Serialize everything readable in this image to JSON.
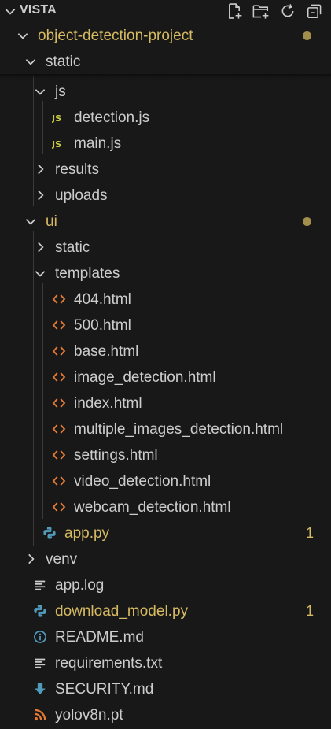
{
  "header": {
    "title": "VISTA",
    "actions": [
      {
        "name": "new-file-icon"
      },
      {
        "name": "new-folder-icon"
      },
      {
        "name": "refresh-icon"
      },
      {
        "name": "collapse-all-icon"
      }
    ]
  },
  "colors": {
    "background": "#181818",
    "text": "#cccccc",
    "modified": "#d6ba62",
    "dot": "#a18f4c",
    "js": "#cbcb41",
    "html": "#e37933",
    "python": "#519aba",
    "info": "#519aba",
    "download": "#519aba",
    "rss": "#e37933"
  },
  "tree": [
    {
      "label": "object-detection-project",
      "icon": "chevron-down-icon",
      "modified": true,
      "badge": "dot"
    },
    {
      "label": "static",
      "icon": "chevron-down-icon"
    },
    {
      "label": "js",
      "icon": "chevron-down-icon"
    },
    {
      "label": "detection.js",
      "icon": "js-file-icon"
    },
    {
      "label": "main.js",
      "icon": "js-file-icon"
    },
    {
      "label": "results",
      "icon": "chevron-right-icon"
    },
    {
      "label": "uploads",
      "icon": "chevron-right-icon"
    },
    {
      "label": "ui",
      "icon": "chevron-down-icon",
      "modified": true,
      "badge": "dot"
    },
    {
      "label": "static",
      "icon": "chevron-right-icon"
    },
    {
      "label": "templates",
      "icon": "chevron-down-icon"
    },
    {
      "label": "404.html",
      "icon": "html-file-icon"
    },
    {
      "label": "500.html",
      "icon": "html-file-icon"
    },
    {
      "label": "base.html",
      "icon": "html-file-icon"
    },
    {
      "label": "image_detection.html",
      "icon": "html-file-icon"
    },
    {
      "label": "index.html",
      "icon": "html-file-icon"
    },
    {
      "label": "multiple_images_detection.html",
      "icon": "html-file-icon"
    },
    {
      "label": "settings.html",
      "icon": "html-file-icon"
    },
    {
      "label": "video_detection.html",
      "icon": "html-file-icon"
    },
    {
      "label": "webcam_detection.html",
      "icon": "html-file-icon"
    },
    {
      "label": "app.py",
      "icon": "python-file-icon",
      "modified": true,
      "count": "1"
    },
    {
      "label": "venv",
      "icon": "chevron-right-icon"
    },
    {
      "label": "app.log",
      "icon": "log-file-icon"
    },
    {
      "label": "download_model.py",
      "icon": "python-file-icon",
      "modified": true,
      "count": "1"
    },
    {
      "label": "README.md",
      "icon": "info-icon"
    },
    {
      "label": "requirements.txt",
      "icon": "text-file-icon"
    },
    {
      "label": "SECURITY.md",
      "icon": "download-icon"
    },
    {
      "label": "yolov8n.pt",
      "icon": "rss-icon"
    }
  ]
}
